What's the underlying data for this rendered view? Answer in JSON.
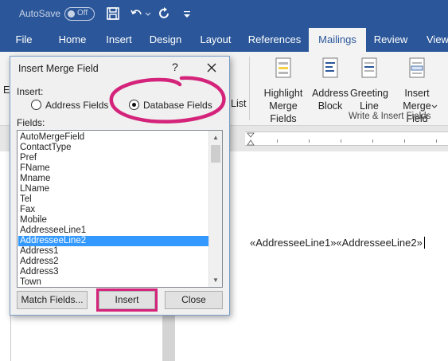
{
  "titlebar": {
    "autosave_label": "AutoSave",
    "autosave_state": "Off"
  },
  "ribbon_tabs": [
    {
      "label": "File"
    },
    {
      "label": "Home"
    },
    {
      "label": "Insert"
    },
    {
      "label": "Design"
    },
    {
      "label": "Layout"
    },
    {
      "label": "References"
    },
    {
      "label": "Mailings"
    },
    {
      "label": "Review"
    },
    {
      "label": "View"
    }
  ],
  "active_tab": "Mailings",
  "ribbon": {
    "partial_left": "E",
    "partial_list": "List",
    "highlight_merge_fields": "Highlight\nMerge Fields",
    "address_block": "Address\nBlock",
    "greeting_line": "Greeting\nLine",
    "insert_merge_field": "Insert Merge\nField",
    "group_label": "Write & Insert Fields"
  },
  "document": {
    "merge_text": "«AddresseeLine1»«AddresseeLine2»"
  },
  "dialog": {
    "title": "Insert Merge Field",
    "help": "?",
    "insert_label": "Insert:",
    "radio_address": "Address Fields",
    "radio_database": "Database Fields",
    "selected_radio": "Database Fields",
    "fields_label": "Fields:",
    "fields": [
      "AutoMergeField",
      "ContactType",
      "Pref",
      "FName",
      "Mname",
      "LName",
      "Tel",
      "Fax",
      "Mobile",
      "AddresseeLine1",
      "AddresseeLine2",
      "Address1",
      "Address2",
      "Address3",
      "Town"
    ],
    "selected_field": "AddresseeLine2",
    "buttons": {
      "match_fields": "Match Fields...",
      "insert": "Insert",
      "close": "Close"
    }
  },
  "colors": {
    "ribbon_blue": "#2b579a",
    "annotation": "#d4237a",
    "selection": "#3399ff"
  }
}
